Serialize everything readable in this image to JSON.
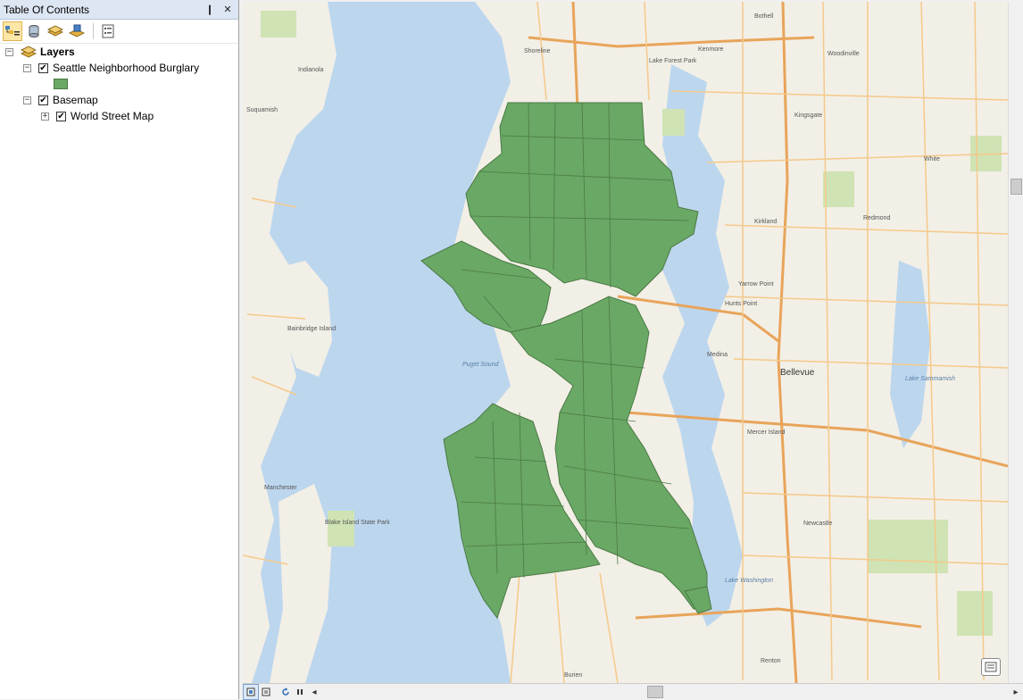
{
  "panel": {
    "title": "Table Of Contents",
    "pin_glyph": "❙",
    "close_glyph": "✕"
  },
  "toolbar": {
    "icons": [
      "list-by-drawing-order-icon",
      "list-by-source-icon",
      "list-by-visibility-icon",
      "list-by-selection-icon",
      "options-icon"
    ]
  },
  "tree": {
    "root_label": "Layers",
    "layer1_label": "Seattle Neighborhood Burglary",
    "layer1_symbol_color": "#6aa865",
    "group_label": "Basemap",
    "sublayer_label": "World Street Map",
    "expander_minus": "−",
    "expander_plus": "+",
    "check_glyph": "✔"
  },
  "map": {
    "water_color": "#bcd6ee",
    "land_color": "#f2efe6",
    "polygon_fill": "#6aa865",
    "polygon_stroke": "#4a7a44",
    "road_major": "#e8a45a",
    "road_minor": "#f5c98a",
    "park_color": "#cfe3b4",
    "labels": {
      "shoreline": "Shoreline",
      "kenmore": "Kenmore",
      "bothell": "Bothell",
      "woodinville": "Woodinville",
      "lake_forest_park": "Lake Forest Park",
      "kingsgate": "Kingsgate",
      "kirkland": "Kirkland",
      "redmond": "Redmond",
      "white": "White",
      "indianola": "Indianola",
      "suquamish": "Suquamish",
      "bainbridge_island": "Bainbridge Island",
      "puget_sound": "Puget Sound",
      "yarrow_point": "Yarrow Point",
      "hunts_point": "Hunts Point",
      "medina": "Medina",
      "bellevue": "Bellevue",
      "mercer_island": "Mercer Island",
      "newport_hills": "Newcastle",
      "manchester": "Manchester",
      "blake_island": "Blake Island State Park",
      "lake_washington": "Lake Washington",
      "lake_sammamish": "Lake Sammamish",
      "burien": "Burien",
      "renton": "Renton"
    }
  },
  "statusbar": {
    "icons": [
      "data-view-icon",
      "layout-view-icon",
      "refresh-icon",
      "pause-icon"
    ],
    "left_arrow": "◂",
    "right_arrow": "▸"
  }
}
